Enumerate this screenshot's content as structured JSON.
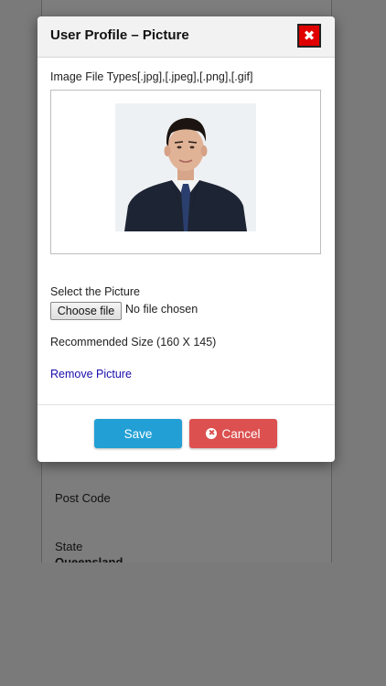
{
  "modal": {
    "title": "User Profile – Picture",
    "close_glyph": "✖",
    "file_types_label": "Image File Types[.jpg],[.jpeg],[.png],[.gif]",
    "select_label": "Select the Picture",
    "choose_file_button": "Choose file",
    "no_file_text": "No file chosen",
    "recommended_size": "Recommended Size (160 X 145)",
    "remove_link": "Remove Picture",
    "save_button": "Save",
    "cancel_button": "Cancel",
    "cancel_icon_glyph": "✖"
  },
  "background": {
    "fields": [
      {
        "label": "Post Code",
        "value": ""
      },
      {
        "label": "State",
        "value": "Queensland"
      }
    ]
  },
  "colors": {
    "close_button": "#e00000",
    "save_button": "#22a0d6",
    "cancel_button": "#dc5050",
    "link": "#1a0dab"
  }
}
